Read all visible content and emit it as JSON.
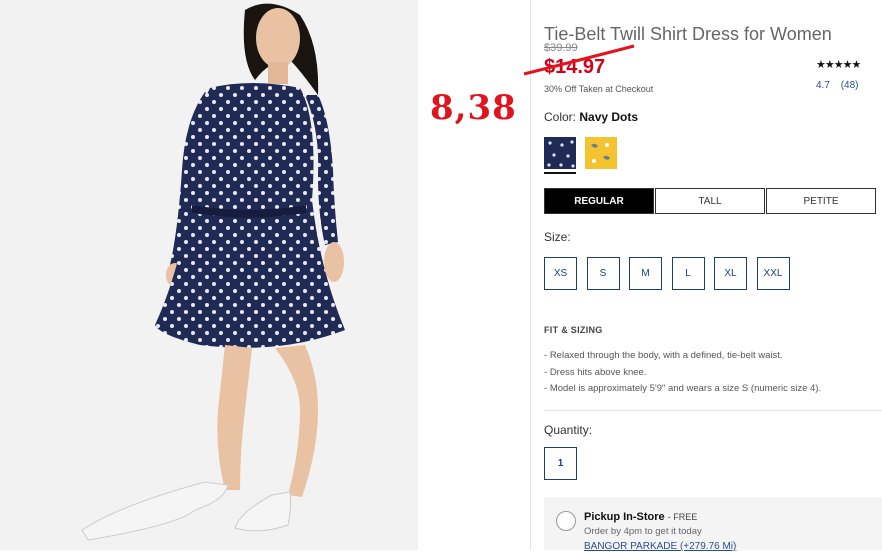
{
  "annotation": {
    "handwritten_price": "8,38"
  },
  "product": {
    "title": "Tie-Belt Twill Shirt Dress for Women",
    "old_price": "$39.99",
    "sale_price": "$14.97",
    "promo_note": "30% Off Taken at Checkout",
    "rating": {
      "stars": "★★★★★",
      "score": "4.7",
      "reviews": "(48)"
    }
  },
  "color": {
    "label": "Color:",
    "selected": "Navy Dots",
    "options": [
      "navy-dots",
      "yellow-floral"
    ]
  },
  "fit_tabs": [
    {
      "label": "REGULAR",
      "active": true
    },
    {
      "label": "TALL",
      "active": false
    },
    {
      "label": "PETITE",
      "active": false
    }
  ],
  "size": {
    "label": "Size:",
    "options": [
      "XS",
      "S",
      "M",
      "L",
      "XL",
      "XXL"
    ]
  },
  "fit_sizing": {
    "heading": "FIT & SIZING",
    "bullets": [
      "Relaxed through the body, with a defined, tie-belt waist.",
      "Dress hits above knee.",
      "Model is approximately 5'9\" and wears a size S (numeric size 4)."
    ]
  },
  "quantity": {
    "label": "Quantity:",
    "value": "1"
  },
  "pickup": {
    "title": "Pickup In-Store",
    "free": "- FREE",
    "subtitle": "Order by 4pm to get it today",
    "store": "BANGOR PARKADE  (+279.76 Mi)"
  },
  "colors": {
    "navy": "#1f2a55",
    "yellow": "#f4c430",
    "sale_red": "#d0021b",
    "link_blue": "#2a4d8f"
  }
}
